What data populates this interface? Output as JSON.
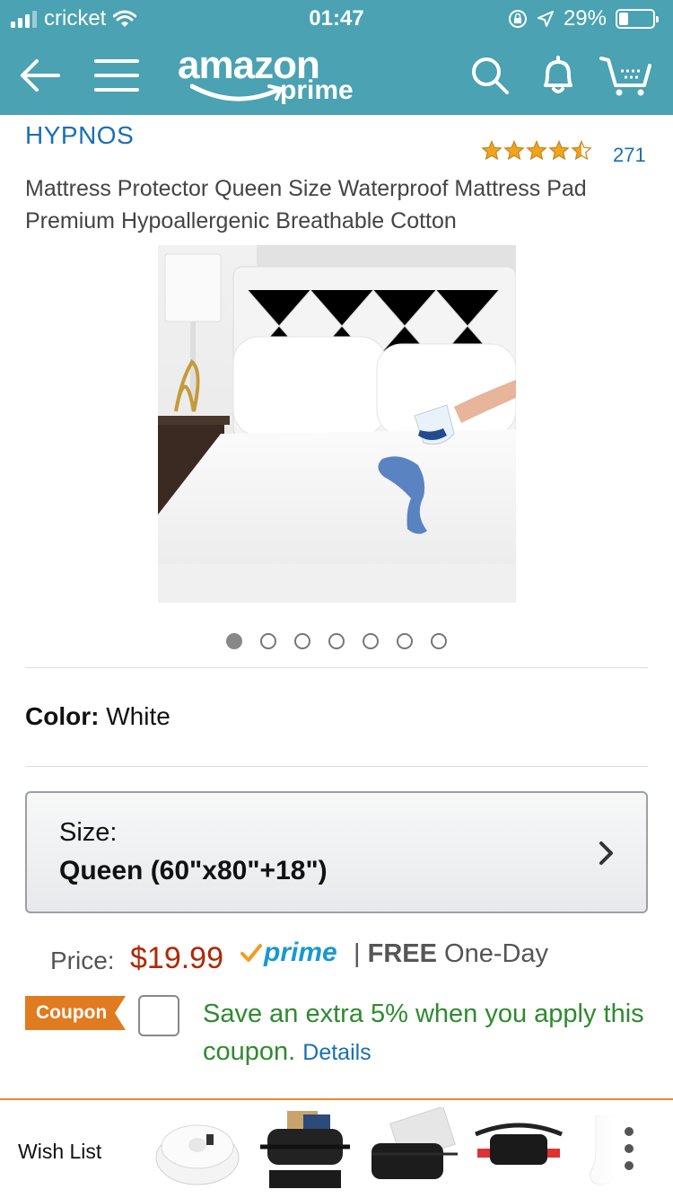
{
  "status_bar": {
    "carrier": "cricket",
    "time": "01:47",
    "battery": "29%",
    "battery_fraction": 0.29
  },
  "nav": {
    "logo_word": "amazon",
    "logo_sub": "prime",
    "icons": [
      "back-arrow-icon",
      "menu-icon",
      "search-icon",
      "bell-icon",
      "cart-icon"
    ]
  },
  "product": {
    "brand": "HYPNOS",
    "rating_stars": 4.5,
    "rating_count": "271",
    "title": "Mattress Protector Queen Size Waterproof Mattress Pad Premium Hypoallergenic Breathable Cotton",
    "image_count": 7,
    "image_active_index": 0
  },
  "color": {
    "label": "Color:",
    "value": "White"
  },
  "size": {
    "label": "Size:",
    "value": "Queen (60\"x80\"+18\")"
  },
  "price": {
    "label": "Price:",
    "value": "$19.99",
    "prime_text": "prime",
    "shipping_sep": "|",
    "shipping_free": "FREE",
    "shipping_speed": "One-Day"
  },
  "coupon": {
    "tag": "Coupon",
    "text": "Save an extra 5% when you apply this coupon.",
    "details": "Details"
  },
  "bottom_bar": {
    "wish_list": "Wish List"
  },
  "colors": {
    "nav_bg": "#4aa2b2",
    "link": "#1a6fb3",
    "price": "#b12704",
    "coupon_green": "#2e8b2e",
    "coupon_tag": "#e07b20",
    "star": "#f0a41c"
  }
}
